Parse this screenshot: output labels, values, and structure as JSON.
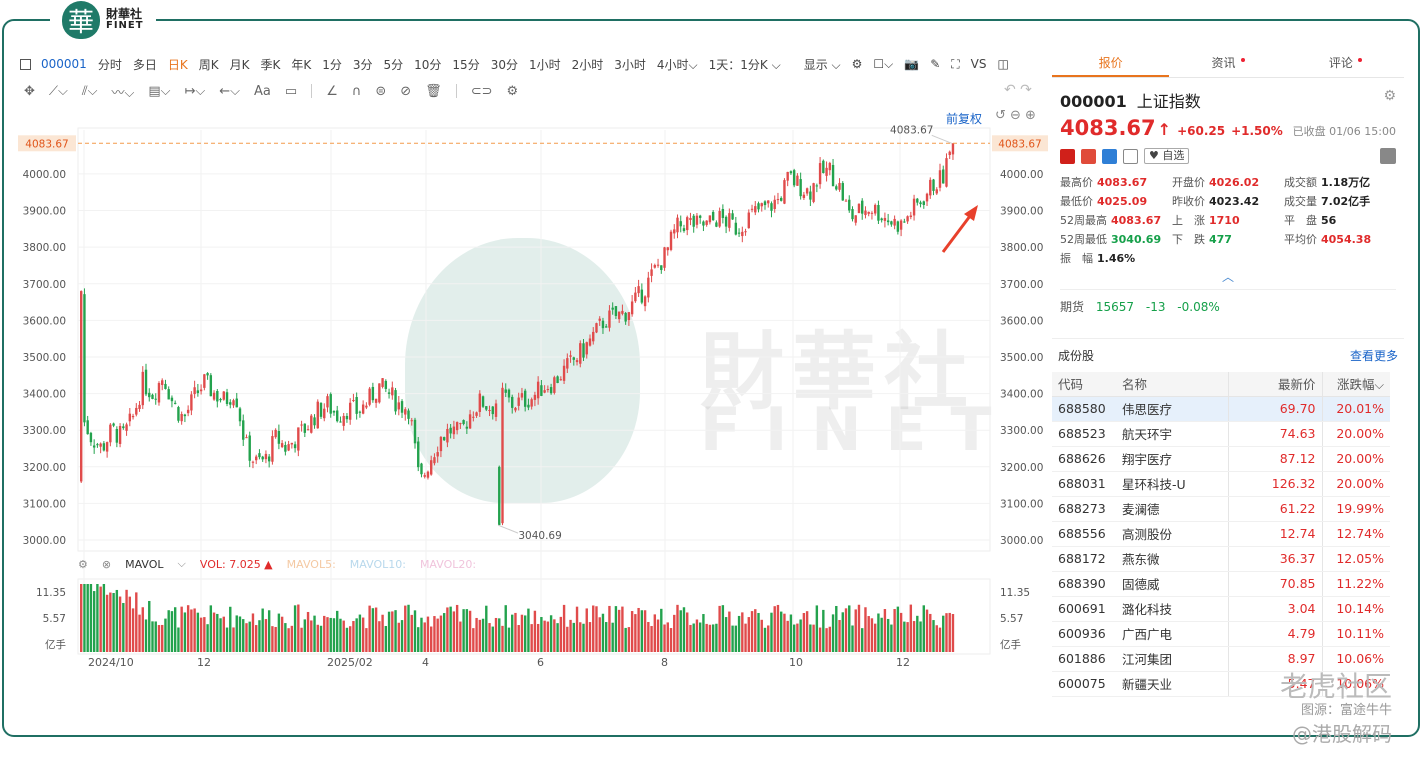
{
  "brand": {
    "cn": "財華社",
    "en": "FINET",
    "glyph": "華"
  },
  "toolbar": {
    "code": "000001",
    "periods": [
      "分时",
      "多日",
      "日K",
      "周K",
      "月K",
      "季K",
      "年K",
      "1分",
      "3分",
      "5分",
      "10分",
      "15分",
      "30分",
      "1小时",
      "2小时",
      "3小时",
      "4小时⌵",
      "1天：1分K ⌵"
    ],
    "active_period": "日K",
    "display_label": "显示 ⌵",
    "vs_label": "VS",
    "adjust_label": "前复权"
  },
  "chart": {
    "last_price_label": "4083.67",
    "high_label": "4083.67",
    "low_label": "3040.69",
    "y_ticks": [
      "4000.00",
      "3900.00",
      "3800.00",
      "3700.00",
      "3600.00",
      "3500.00",
      "3400.00",
      "3300.00",
      "3200.00",
      "3100.00",
      "3000.00"
    ],
    "x_ticks": [
      "2024/10",
      "12",
      "2025/02",
      "4",
      "6",
      "8",
      "10",
      "12"
    ],
    "vol_ticks": [
      "11.35",
      "5.57",
      "亿手"
    ]
  },
  "vol_legend": {
    "mavol": "MAVOL",
    "vol": "VOL: 7.025 ▲",
    "mavol5": "MAVOL5:",
    "mavol10": "MAVOL10:",
    "mavol20": "MAVOL20:"
  },
  "chart_data": {
    "type": "candlestick",
    "title": "",
    "xlabel": "",
    "ylabel": "",
    "ylim": [
      2970,
      4120
    ],
    "last_close": 4083.67,
    "high": 4083.67,
    "low": 3040.69,
    "x_ticks": [
      "2024/10",
      "12",
      "2025/02",
      "4",
      "6",
      "8",
      "10",
      "12"
    ],
    "close_path_approx": [
      3340,
      3280,
      3250,
      3300,
      3280,
      3330,
      3430,
      3400,
      3450,
      3370,
      3330,
      3390,
      3430,
      3400,
      3380,
      3410,
      3260,
      3210,
      3220,
      3280,
      3250,
      3280,
      3310,
      3350,
      3370,
      3340,
      3360,
      3350,
      3380,
      3420,
      3400,
      3370,
      3360,
      3150,
      3220,
      3280,
      3300,
      3290,
      3350,
      3380,
      3360,
      3400,
      3370,
      3380,
      3390,
      3420,
      3430,
      3460,
      3490,
      3520,
      3560,
      3600,
      3610,
      3620,
      3650,
      3690,
      3740,
      3780,
      3850,
      3870,
      3860,
      3860,
      3880,
      3870,
      3850,
      3880,
      3900,
      3910,
      3930,
      3990,
      3970,
      3950,
      4000,
      4010,
      3960,
      3880,
      3900,
      3910,
      3890,
      3870,
      3860,
      3900,
      3930,
      3970,
      3990,
      4083.67
    ]
  },
  "quote": {
    "tabs": [
      "报价",
      "资讯",
      "评论"
    ],
    "code": "000001",
    "name": "上证指数",
    "price": "4083.67",
    "arrow": "↑",
    "change": "+60.25",
    "change_pct": "+1.50%",
    "status": "已收盘 01/06 15:00",
    "watch_label": "♥ 自选",
    "stats": [
      {
        "k": "最高价",
        "v": "4083.67",
        "c": "red"
      },
      {
        "k": "开盘价",
        "v": "4026.02",
        "c": "red"
      },
      {
        "k": "成交额",
        "v": "1.18万亿",
        "c": "dark"
      },
      {
        "k": "最低价",
        "v": "4025.09",
        "c": "red"
      },
      {
        "k": "昨收价",
        "v": "4023.42",
        "c": "dark"
      },
      {
        "k": "成交量",
        "v": "7.02亿手",
        "c": "dark"
      },
      {
        "k": "52周最高",
        "v": "4083.67",
        "c": "red"
      },
      {
        "k": "上　涨",
        "v": "1710",
        "c": "red"
      },
      {
        "k": "平　盘",
        "v": "56",
        "c": "dark"
      },
      {
        "k": "52周最低",
        "v": "3040.69",
        "c": "green"
      },
      {
        "k": "下　跌",
        "v": "477",
        "c": "green"
      },
      {
        "k": "平均价",
        "v": "4054.38",
        "c": "red"
      },
      {
        "k": "振　幅",
        "v": "1.46%",
        "c": "dark"
      }
    ],
    "futures": {
      "label": "期货",
      "price": "15657",
      "change": "-13",
      "pct": "-0.08%"
    }
  },
  "components": {
    "title": "成份股",
    "more": "查看更多",
    "headers": [
      "代码",
      "名称",
      "最新价",
      "涨跌幅⌵"
    ],
    "rows": [
      [
        "688580",
        "伟思医疗",
        "69.70",
        "20.01%"
      ],
      [
        "688523",
        "航天环宇",
        "74.63",
        "20.00%"
      ],
      [
        "688626",
        "翔宇医疗",
        "87.12",
        "20.00%"
      ],
      [
        "688031",
        "星环科技-U",
        "126.32",
        "20.00%"
      ],
      [
        "688273",
        "麦澜德",
        "61.22",
        "19.99%"
      ],
      [
        "688556",
        "高测股份",
        "12.74",
        "12.74%"
      ],
      [
        "688172",
        "燕东微",
        "36.37",
        "12.05%"
      ],
      [
        "688390",
        "固德威",
        "70.85",
        "11.22%"
      ],
      [
        "600691",
        "潞化科技",
        "3.04",
        "10.14%"
      ],
      [
        "600936",
        "广西广电",
        "4.79",
        "10.11%"
      ],
      [
        "601886",
        "江河集团",
        "8.97",
        "10.06%"
      ],
      [
        "600075",
        "新疆天业",
        "5.47",
        "10.06%"
      ]
    ]
  },
  "watermark": {
    "cn": "財華社",
    "en": "FINET"
  },
  "credit": {
    "forum": "老虎社区",
    "source": "图源：富途牛牛",
    "handle": "@港股解码"
  }
}
